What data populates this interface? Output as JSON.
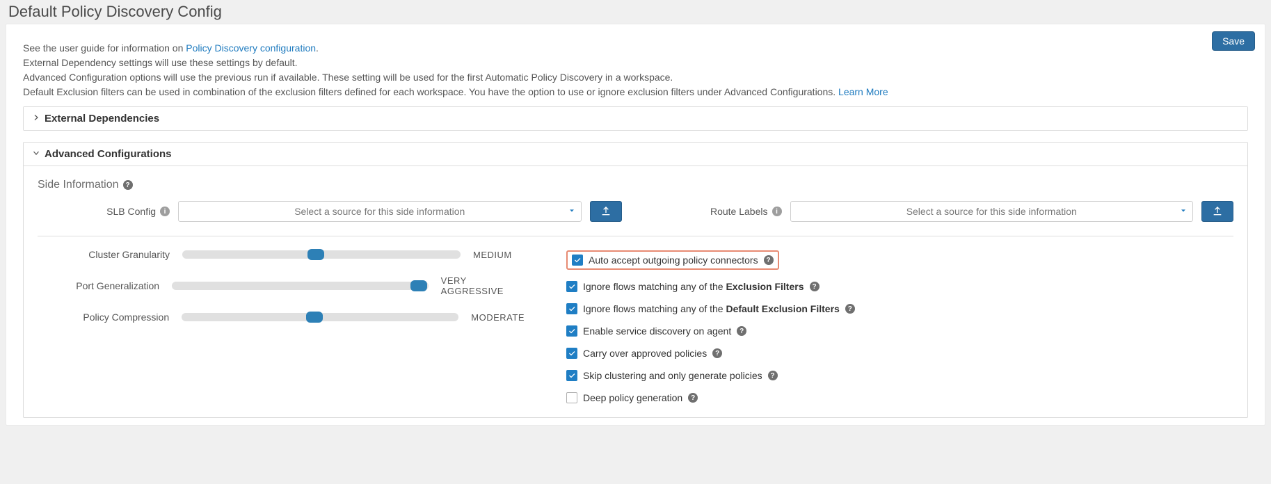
{
  "page_title": "Default Policy Discovery Config",
  "save_label": "Save",
  "intro": {
    "p1_pre": "See the user guide for information on ",
    "p1_link": "Policy Discovery configuration",
    "p1_post": ".",
    "p2": "External Dependency settings will use these settings by default.",
    "p3": "Advanced Configuration options will use the previous run if available. These setting will be used for the first Automatic Policy Discovery in a workspace.",
    "p4_pre": "Default Exclusion filters can be used in combination of the exclusion filters defined for each workspace. You have the option to use or ignore exclusion filters under Advanced Configurations. ",
    "p4_link": "Learn More"
  },
  "accordion": {
    "external_dependencies": {
      "title": "External Dependencies"
    },
    "advanced": {
      "title": "Advanced Configurations",
      "side_info_heading": "Side Information",
      "slb_label": "SLB Config",
      "route_label": "Route Labels",
      "select_placeholder": "Select a source for this side information"
    }
  },
  "sliders": {
    "cluster": {
      "label": "Cluster Granularity",
      "value": "Medium",
      "pos_pct": 45
    },
    "port": {
      "label": "Port Generalization",
      "value": "Very Aggressive",
      "pos_pct": 93
    },
    "policy": {
      "label": "Policy Compression",
      "value": "Moderate",
      "pos_pct": 45
    }
  },
  "checks": {
    "auto_accept": {
      "checked": true,
      "label": "Auto accept outgoing policy connectors"
    },
    "ignore_excl": {
      "checked": true,
      "pre": "Ignore flows matching any of the ",
      "bold": "Exclusion Filters"
    },
    "ignore_def": {
      "checked": true,
      "pre": "Ignore flows matching any of the ",
      "bold": "Default Exclusion Filters"
    },
    "service_disc": {
      "checked": true,
      "label": "Enable service discovery on agent"
    },
    "carry": {
      "checked": true,
      "label": "Carry over approved policies"
    },
    "skip": {
      "checked": true,
      "label": "Skip clustering and only generate policies"
    },
    "deep": {
      "checked": false,
      "label": "Deep policy generation"
    }
  }
}
